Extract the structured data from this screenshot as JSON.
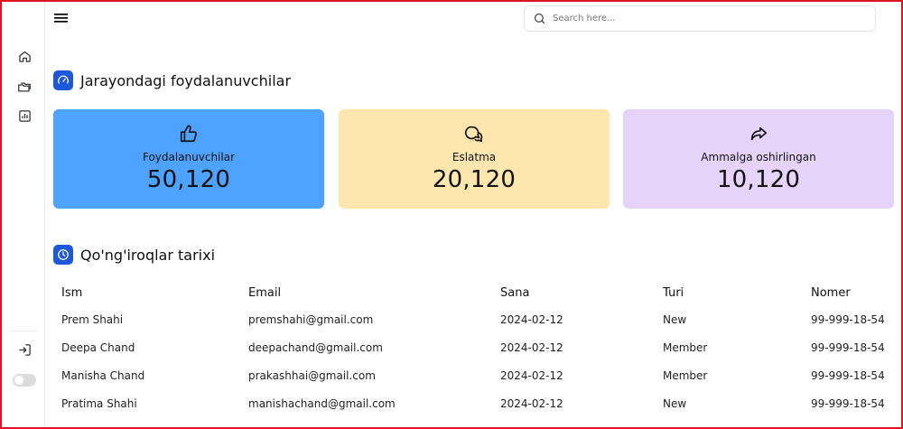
{
  "header": {
    "search_placeholder": "Search here..."
  },
  "sections": {
    "active_users_title": "Jarayondagi foydalanuvchilar",
    "call_history_title": "Qo'ng'iroqlar tarixi"
  },
  "cards": [
    {
      "label": "Foydalanuvchilar",
      "value": "50,120",
      "icon": "thumbs-up-icon",
      "color": "#4da3ff"
    },
    {
      "label": "Eslatma",
      "value": "20,120",
      "icon": "chat-bubbles-icon",
      "color": "#fde7ae"
    },
    {
      "label": "Ammalga oshirlingan",
      "value": "10,120",
      "icon": "share-arrow-icon",
      "color": "#e6d3fa"
    }
  ],
  "table": {
    "columns": [
      "Ism",
      "Email",
      "Sana",
      "Turi",
      "Nomer"
    ],
    "rows": [
      [
        "Prem Shahi",
        "premshahi@gmail.com",
        "2024-02-12",
        "New",
        "99-999-18-54"
      ],
      [
        "Deepa Chand",
        "deepachand@gmail.com",
        "2024-02-12",
        "Member",
        "99-999-18-54"
      ],
      [
        "Manisha Chand",
        "prakashhai@gmail.com",
        "2024-02-12",
        "Member",
        "99-999-18-54"
      ],
      [
        "Pratima Shahi",
        "manishachand@gmail.com",
        "2024-02-12",
        "New",
        "99-999-18-54"
      ]
    ]
  },
  "colors": {
    "accent": "#1c58d9",
    "frame": "#e0141e"
  }
}
